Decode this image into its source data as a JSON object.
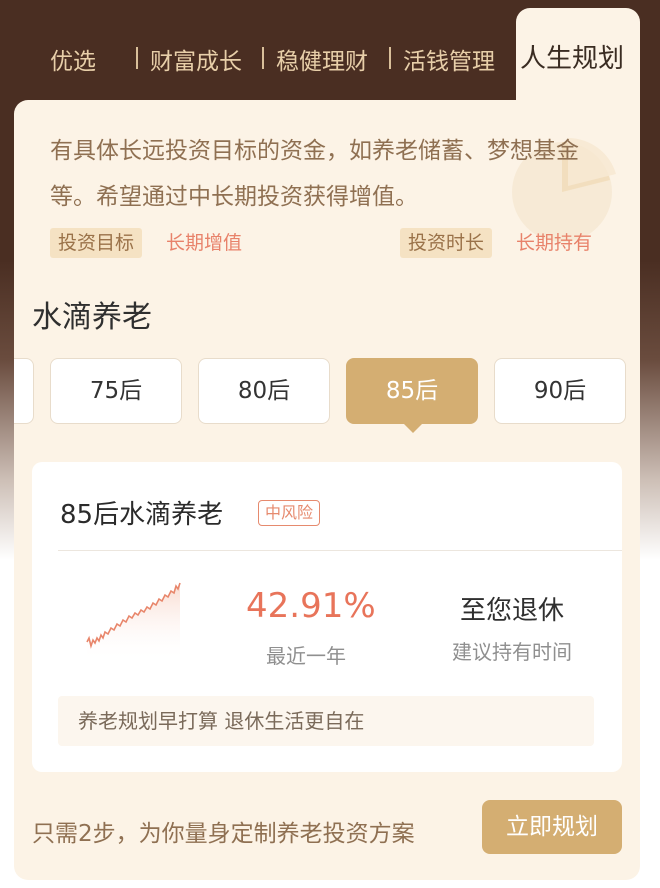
{
  "tabs": {
    "items": [
      "优选",
      "财富成长",
      "稳健理财",
      "活钱管理"
    ],
    "active": "人生规划"
  },
  "intro": {
    "text": "有具体长远投资目标的资金，如养老储蓄、梦想基金等。希望通过中长期投资获得增值。",
    "goal_key": "投资目标",
    "goal_val": "长期增值",
    "term_key": "投资时长",
    "term_val": "长期持有"
  },
  "section": {
    "title": "水滴养老"
  },
  "chips": [
    "75后",
    "80后",
    "85后",
    "90后"
  ],
  "chips_active_index": 2,
  "card": {
    "title": "85后水滴养老",
    "risk": "中风险",
    "rate": "42.91%",
    "rate_label": "最近一年",
    "hold": "至您退休",
    "hold_label": "建议持有时间",
    "slogan": "养老规划早打算 退休生活更自在"
  },
  "footer": {
    "text": "只需2步，为你量身定制养老投资方案",
    "cta": "立即规划"
  },
  "colors": {
    "accent": "#d4ae72",
    "rate": "#e8745a",
    "tag_value": "#e8826a",
    "panel_bg": "#fcf3e6",
    "header_bg": "#4a2e22"
  },
  "icons": {
    "decoration": "pie-chart-icon",
    "sparkline": "sparkline-chart"
  }
}
